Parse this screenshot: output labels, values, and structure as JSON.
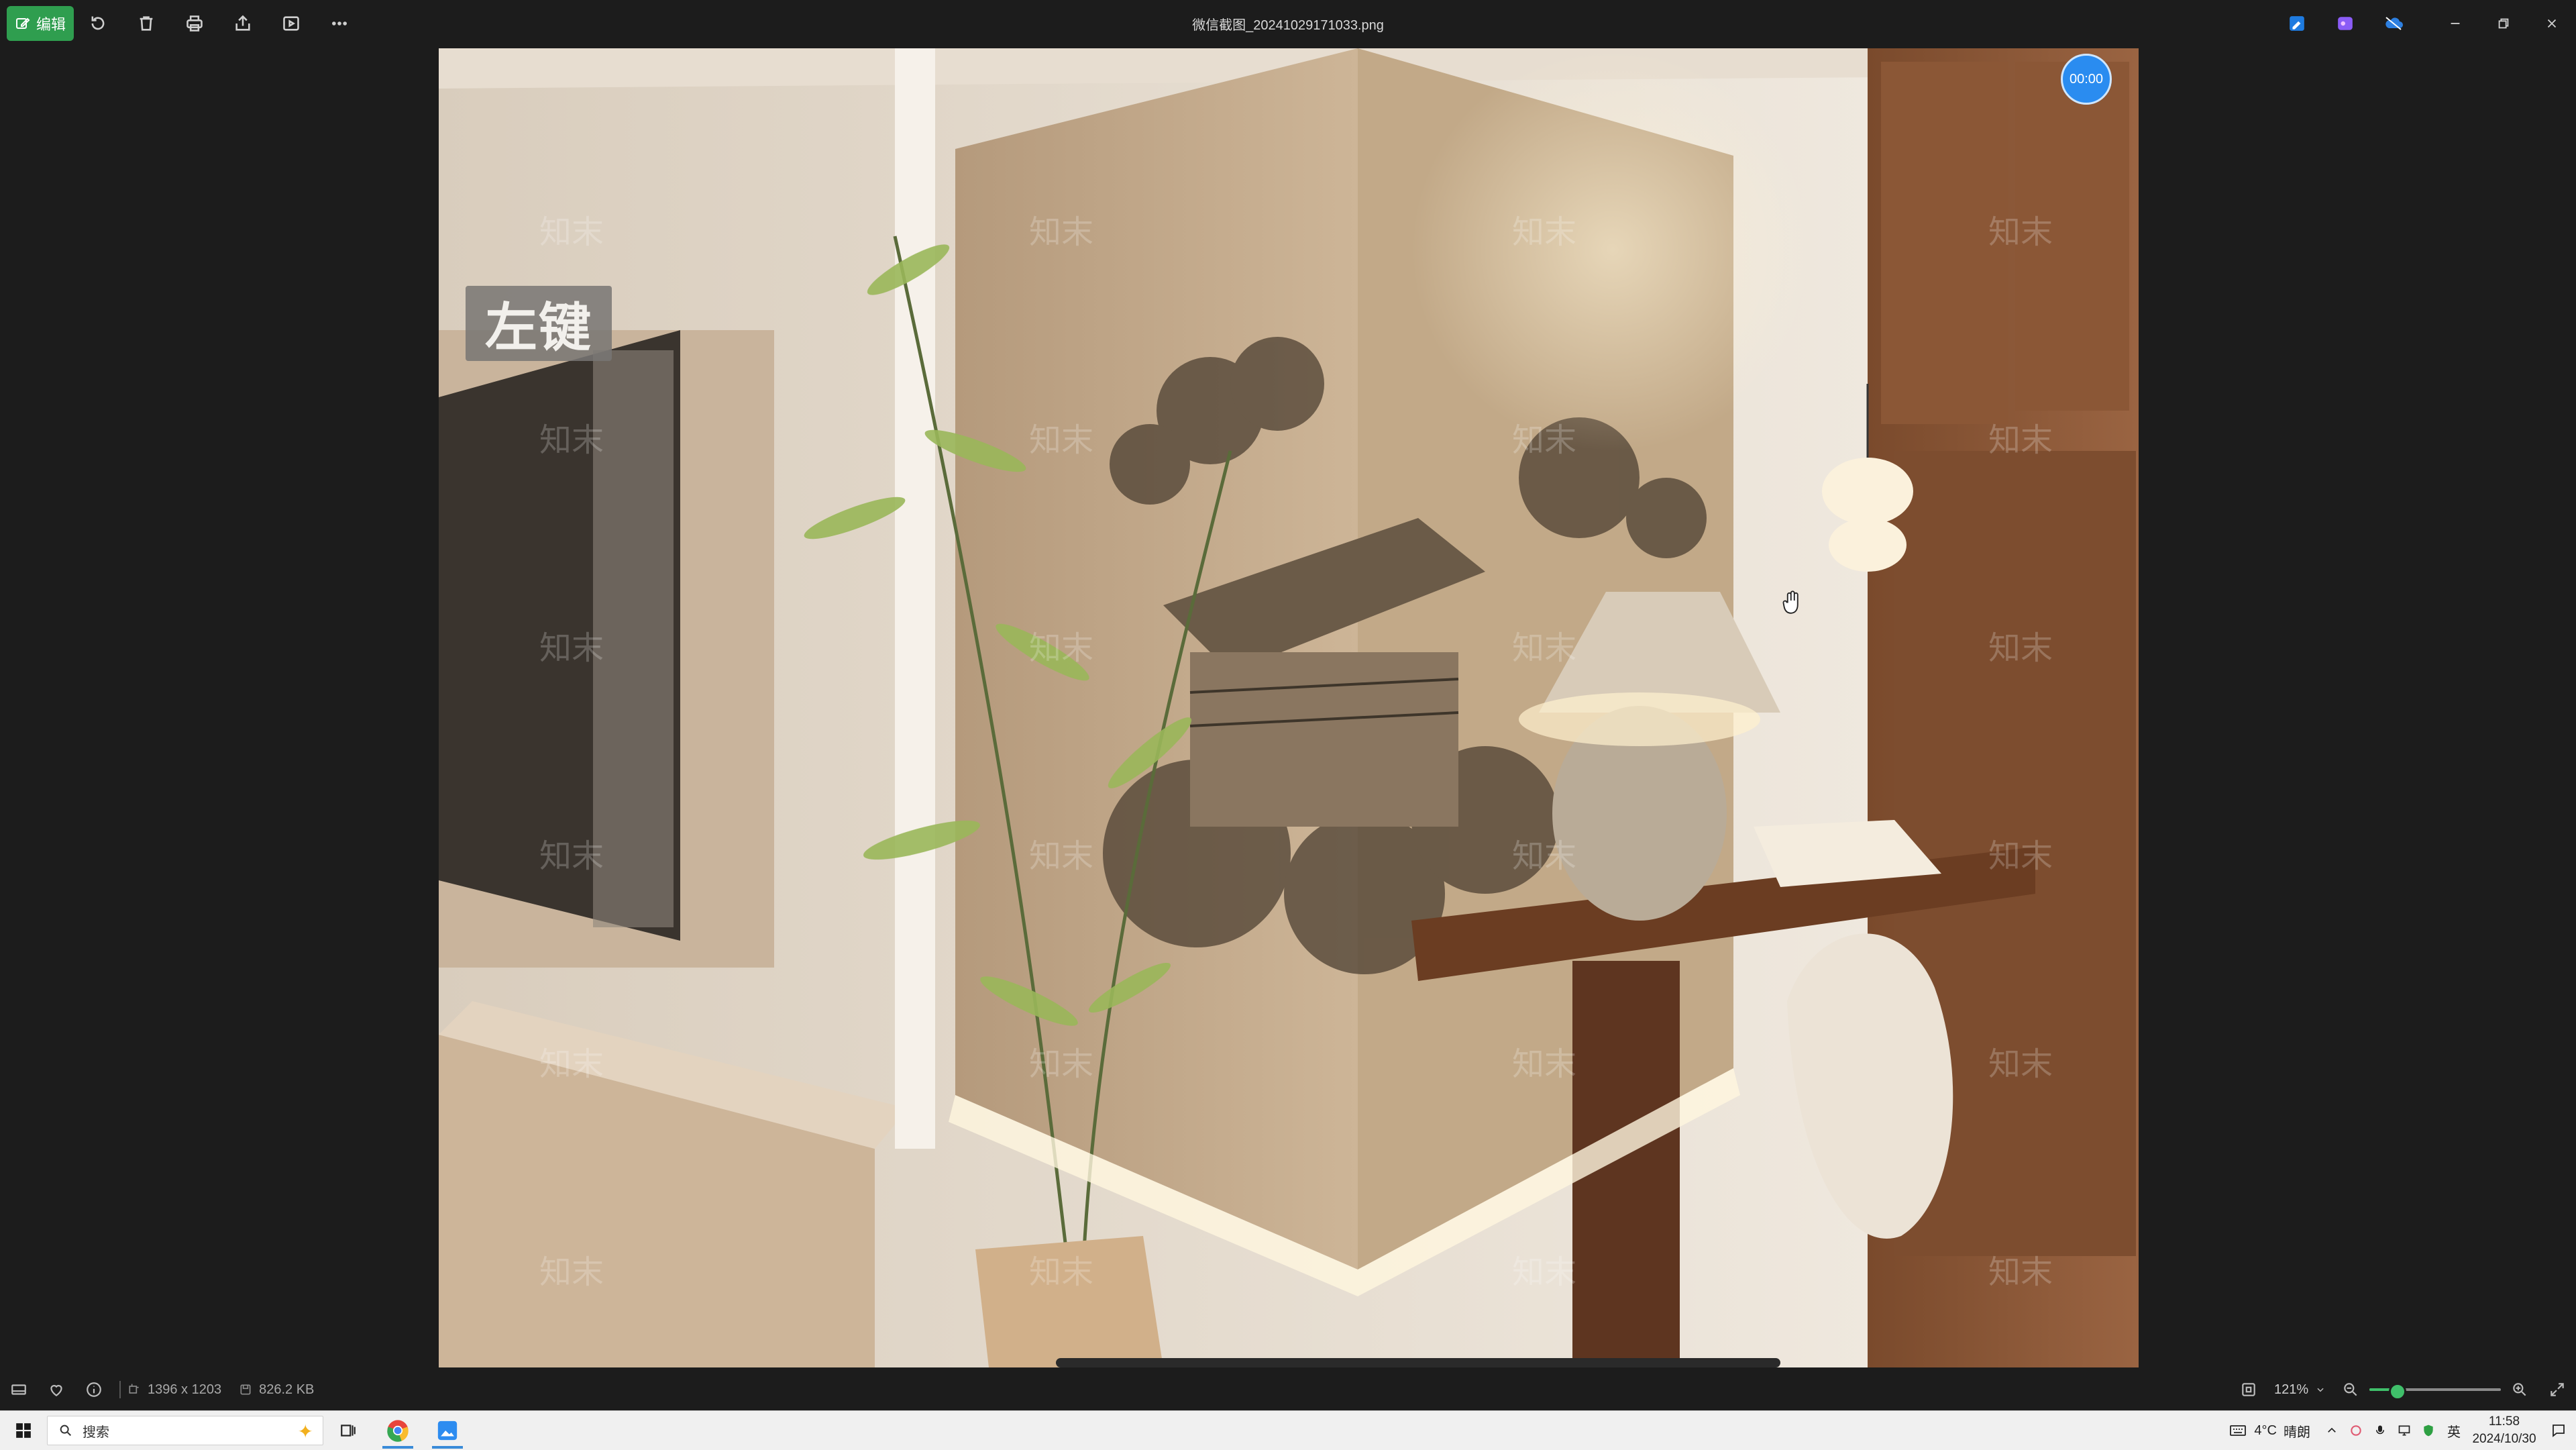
{
  "window": {
    "title": "微信截图_20241029171033.png",
    "edit_label": "编辑"
  },
  "toolbar": {
    "icons": [
      "rotate-icon",
      "delete-icon",
      "print-icon",
      "share-icon",
      "slideshow-icon",
      "more-icon"
    ]
  },
  "viewer": {
    "overlay_label": "左键",
    "timer": "00:00",
    "watermark": "知末"
  },
  "status": {
    "dimensions": "1396 x 1203",
    "file_size": "826.2 KB",
    "zoom": "121%",
    "zoom_level": 0.2
  },
  "taskbar": {
    "search_placeholder": "搜索",
    "weather": "4°C",
    "weather_text": "晴朗",
    "ime": "英",
    "time": "11:58",
    "date": "2024/10/30"
  },
  "colors": {
    "edit_button": "#2f9e4f",
    "zoom_accent": "#3fbf6a",
    "timer": "#2a8cf0",
    "taskbar": "#f0f0f0"
  }
}
